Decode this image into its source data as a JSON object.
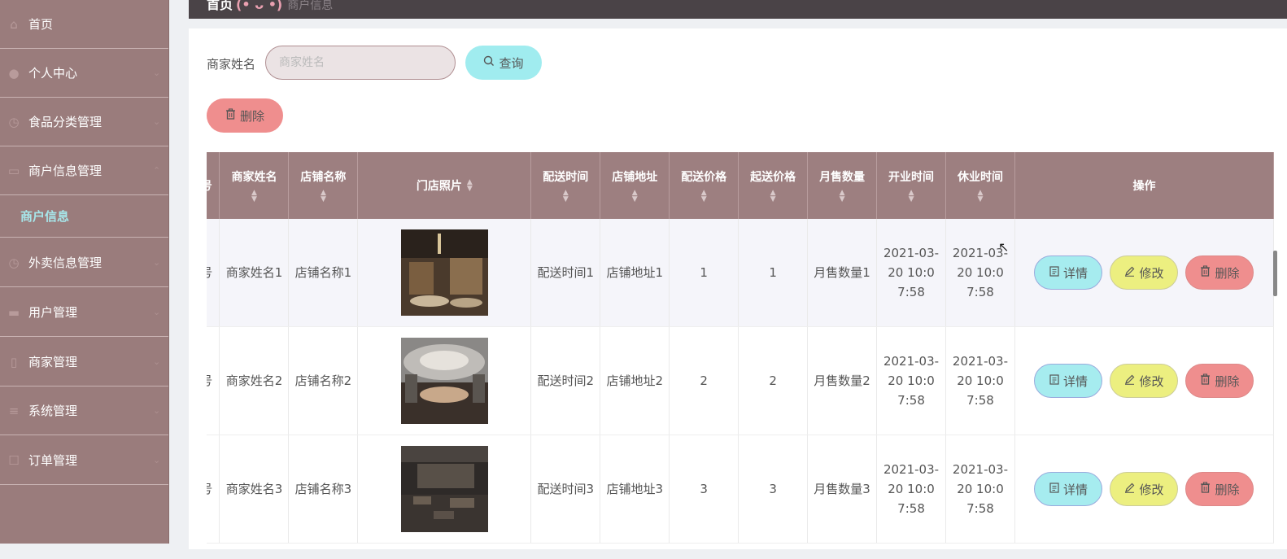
{
  "sidebar": {
    "items": [
      {
        "label": "首页",
        "icon": "home-icon"
      },
      {
        "label": "个人中心",
        "icon": "user-icon"
      },
      {
        "label": "食品分类管理",
        "icon": "clock-icon"
      },
      {
        "label": "商户信息管理",
        "icon": "card-icon"
      },
      {
        "label": "外卖信息管理",
        "icon": "clock-icon"
      },
      {
        "label": "用户管理",
        "icon": "monitor-icon"
      },
      {
        "label": "商家管理",
        "icon": "mic-icon"
      },
      {
        "label": "系统管理",
        "icon": "list-icon"
      },
      {
        "label": "订单管理",
        "icon": "doc-icon"
      }
    ],
    "active_sub": "商户信息"
  },
  "breadcrumb": {
    "home": "首页",
    "mid": "(• ᴗ •)",
    "current": "商户信息"
  },
  "search": {
    "label": "商家姓名",
    "placeholder": "商家姓名",
    "button": "查询"
  },
  "toolbar": {
    "delete_label": "删除"
  },
  "table": {
    "columns": [
      "号",
      "商家姓名",
      "店铺名称",
      "门店照片",
      "配送时间",
      "店铺地址",
      "配送价格",
      "起送价格",
      "月售数量",
      "开业时间",
      "休业时间",
      "操作"
    ],
    "rows": [
      {
        "idx": "号",
        "merchant": "商家姓名1",
        "shop": "店铺名称1",
        "delivery_time": "配送时间1",
        "address": "店铺地址1",
        "delivery_price": "1",
        "min_price": "1",
        "monthly": "月售数量1",
        "open": "2021-03-20 10:07:58",
        "close": "2021-03-20 10:07:58"
      },
      {
        "idx": "号",
        "merchant": "商家姓名2",
        "shop": "店铺名称2",
        "delivery_time": "配送时间2",
        "address": "店铺地址2",
        "delivery_price": "2",
        "min_price": "2",
        "monthly": "月售数量2",
        "open": "2021-03-20 10:07:58",
        "close": "2021-03-20 10:07:58"
      },
      {
        "idx": "号",
        "merchant": "商家姓名3",
        "shop": "店铺名称3",
        "delivery_time": "配送时间3",
        "address": "店铺地址3",
        "delivery_price": "3",
        "min_price": "3",
        "monthly": "月售数量3",
        "open": "2021-03-20 10:07:58",
        "close": "2021-03-20 10:07:58"
      }
    ],
    "actions": {
      "detail": "详情",
      "edit": "修改",
      "delete": "删除"
    }
  },
  "colors": {
    "sidebar": "#9a7c7c",
    "header": "#9d7f80",
    "accent_cyan": "#a0ecef",
    "accent_red": "#ef8e8e",
    "accent_yellow": "#ecef80"
  }
}
